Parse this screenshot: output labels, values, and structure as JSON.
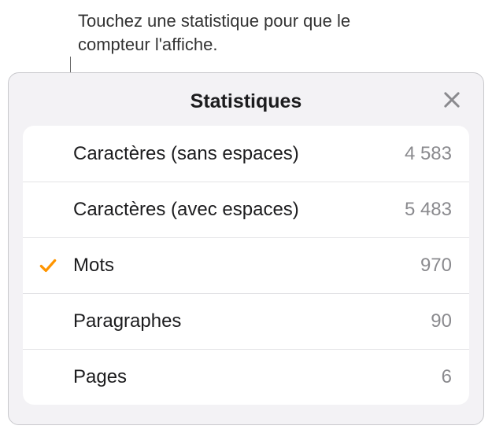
{
  "callout": {
    "text": "Touchez une statistique pour que le compteur l'affiche."
  },
  "panel": {
    "title": "Statistiques"
  },
  "stats": [
    {
      "label": "Caractères (sans espaces)",
      "value": "4 583",
      "selected": false
    },
    {
      "label": "Caractères (avec espaces)",
      "value": "5 483",
      "selected": false
    },
    {
      "label": "Mots",
      "value": "970",
      "selected": true
    },
    {
      "label": "Paragraphes",
      "value": "90",
      "selected": false
    },
    {
      "label": "Pages",
      "value": "6",
      "selected": false
    }
  ]
}
